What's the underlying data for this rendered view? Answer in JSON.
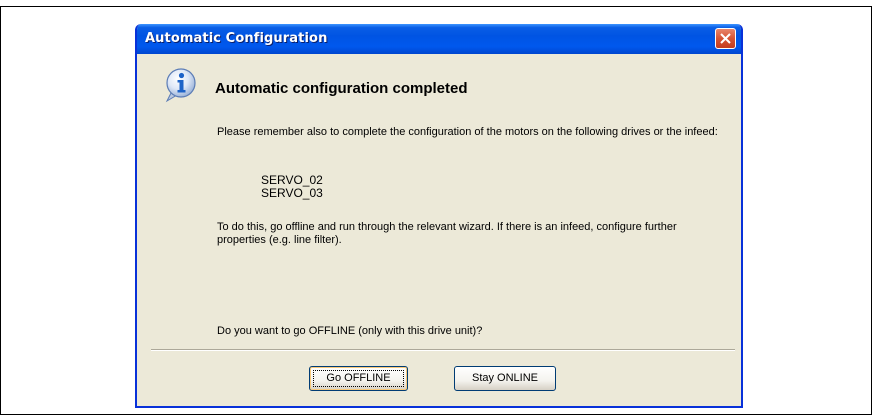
{
  "dialog": {
    "title": "Automatic Configuration",
    "heading": "Automatic configuration completed",
    "paragraph1": "Please remember also to complete the configuration of the motors on the following drives or the infeed:",
    "drives": [
      "SERVO_02",
      "SERVO_03"
    ],
    "paragraph2": "To do this, go offline and run through the relevant wizard. If there is an infeed, configure further properties (e.g. line filter).",
    "question": "Do you want to go OFFLINE (only with this drive unit)?",
    "buttons": {
      "go_offline": "Go OFFLINE",
      "stay_online": "Stay ONLINE"
    }
  },
  "icons": {
    "title_close": "close-icon",
    "message": "info-icon"
  },
  "colors": {
    "titlebar": "#0054e3",
    "dialog_background": "#ece9d8",
    "close_button": "#d65434",
    "info_icon": "#1d63c8"
  }
}
